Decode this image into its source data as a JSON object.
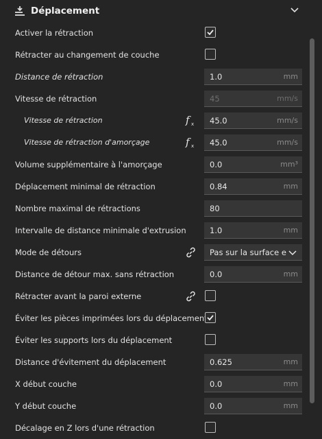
{
  "section": {
    "title": "Déplacement",
    "icon": "travel-icon",
    "collapse_icon": "chevron-down-icon"
  },
  "rows": [
    {
      "label": "Activer la rétraction",
      "control": "checkbox",
      "checked": true
    },
    {
      "label": "Rétracter au changement de couche",
      "control": "checkbox",
      "checked": false
    },
    {
      "label": "Distance de rétraction",
      "control": "input",
      "value": "1.0",
      "unit": "mm"
    },
    {
      "label": "Vitesse de rétraction",
      "control": "input",
      "value": "45",
      "unit": "mm/s",
      "disabled": true
    },
    {
      "label": "Vitesse de rétraction",
      "control": "input",
      "value": "45.0",
      "unit": "mm/s",
      "icon": "function-icon"
    },
    {
      "label": "Vitesse de rétraction d'amorçage",
      "control": "input",
      "value": "45.0",
      "unit": "mm/s",
      "icon": "function-icon"
    },
    {
      "label": "Volume supplémentaire à l'amorçage",
      "control": "input",
      "value": "0.0",
      "unit": "mm³"
    },
    {
      "label": "Déplacement minimal de rétraction",
      "control": "input",
      "value": "0.84",
      "unit": "mm"
    },
    {
      "label": "Nombre maximal de rétractions",
      "control": "input",
      "value": "80",
      "unit": ""
    },
    {
      "label": "Intervalle de distance minimale d'extrusion",
      "control": "input",
      "value": "1.0",
      "unit": "mm"
    },
    {
      "label": "Mode de détours",
      "control": "select",
      "value": "Pas sur la surface e...",
      "icon": "link-icon"
    },
    {
      "label": "Distance de détour max. sans rétraction",
      "control": "input",
      "value": "0.0",
      "unit": "mm"
    },
    {
      "label": "Rétracter avant la paroi externe",
      "control": "checkbox",
      "checked": false,
      "icon": "link-icon"
    },
    {
      "label": "Éviter les pièces imprimées lors du déplacement",
      "control": "checkbox",
      "checked": true
    },
    {
      "label": "Éviter les supports lors du déplacement",
      "control": "checkbox",
      "checked": false
    },
    {
      "label": "Distance d'évitement du déplacement",
      "control": "input",
      "value": "0.625",
      "unit": "mm"
    },
    {
      "label": "X début couche",
      "control": "input",
      "value": "0.0",
      "unit": "mm"
    },
    {
      "label": "Y début couche",
      "control": "input",
      "value": "0.0",
      "unit": "mm"
    },
    {
      "label": "Décalage en Z lors d'une rétraction",
      "control": "checkbox",
      "checked": false
    }
  ],
  "colors": {
    "background": "#252526",
    "field": "#363636",
    "text": "#e6e6e6",
    "unit": "#8a8a8a"
  }
}
